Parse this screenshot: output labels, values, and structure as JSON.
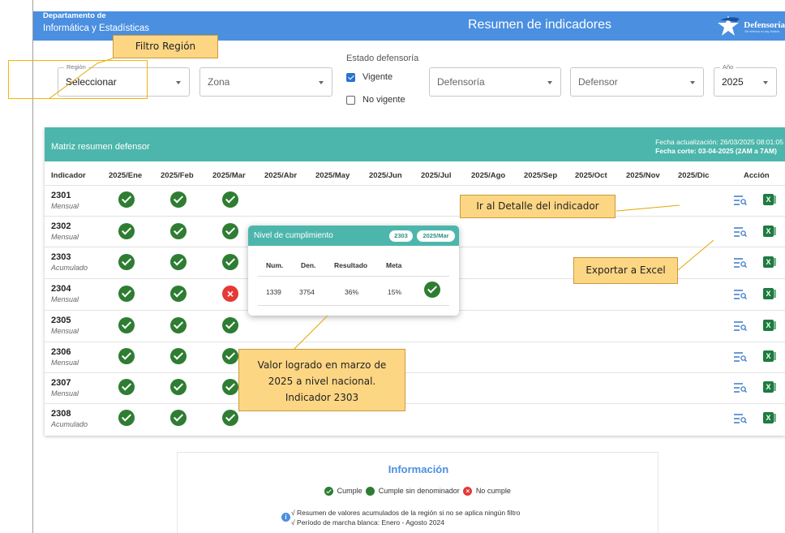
{
  "header": {
    "dept_line1": "Departamento de",
    "dept_line2": "Informática y Estadísticas",
    "title": "Resumen de indicadores",
    "logo_text": "Defensoría",
    "logo_tagline": "Sin defensa no hay Justicia"
  },
  "filters": {
    "region": {
      "legend": "Región",
      "value": "Seleccionar"
    },
    "zona": {
      "placeholder": "Zona"
    },
    "estado": {
      "label": "Estado defensoría",
      "vigente": "Vigente",
      "vigente_checked": true,
      "no_vigente": "No vigente",
      "no_vigente_checked": false
    },
    "defensoria": {
      "placeholder": "Defensoría"
    },
    "defensor": {
      "placeholder": "Defensor"
    },
    "anio": {
      "legend": "Año",
      "value": "2025"
    }
  },
  "matrix": {
    "title": "Matriz resumen defensor",
    "update_label": "Fecha actualización: 26/03/2025 08:01:05",
    "cut_label": "Fecha corte: 03-04-2025 (2AM a 7AM)",
    "columns": [
      "Indicador",
      "2025/Ene",
      "2025/Feb",
      "2025/Mar",
      "2025/Abr",
      "2025/May",
      "2025/Jun",
      "2025/Jul",
      "2025/Ago",
      "2025/Sep",
      "2025/Oct",
      "2025/Nov",
      "2025/Dic",
      "Acción"
    ],
    "rows": [
      {
        "id": "2301",
        "type": "Mensual",
        "status": [
          "ok",
          "ok",
          "ok"
        ]
      },
      {
        "id": "2302",
        "type": "Mensual",
        "status": [
          "ok",
          "ok",
          "ok"
        ]
      },
      {
        "id": "2303",
        "type": "Acumulado",
        "status": [
          "ok",
          "ok",
          "ok"
        ]
      },
      {
        "id": "2304",
        "type": "Mensual",
        "status": [
          "ok",
          "ok",
          "fail"
        ]
      },
      {
        "id": "2305",
        "type": "Mensual",
        "status": [
          "ok",
          "ok",
          "ok"
        ]
      },
      {
        "id": "2306",
        "type": "Mensual",
        "status": [
          "ok",
          "ok",
          "ok"
        ]
      },
      {
        "id": "2307",
        "type": "Mensual",
        "status": [
          "ok",
          "ok",
          "ok"
        ]
      },
      {
        "id": "2308",
        "type": "Acumulado",
        "status": [
          "ok",
          "ok",
          "ok"
        ]
      }
    ],
    "excel_glyph": "X",
    "fail_glyph": "×"
  },
  "popup": {
    "title": "Nivel de cumplimiento",
    "indicator_pill": "2303",
    "period_pill": "2025/Mar",
    "headers": [
      "Num.",
      "Den.",
      "Resultado",
      "Meta"
    ],
    "values": [
      "1339",
      "3754",
      "36%",
      "15%"
    ]
  },
  "callouts": {
    "region": "Filtro Región",
    "detail": "Ir al Detalle del indicador",
    "excel": "Exportar a Excel",
    "value_line1": "Valor logrado en marzo de",
    "value_line2": "2025 a nivel nacional.",
    "value_line3": "Indicador 2303"
  },
  "info": {
    "title": "Información",
    "legend_ok": "Cumple",
    "legend_noden": "Cumple sin denominador",
    "legend_fail": "No cumple",
    "note1": "√ Resumen de valores acumulados de la región si no se aplica ningún filtro",
    "note2": "√ Período de marcha blanca: Enero - Agosto 2024",
    "info_glyph": "i"
  },
  "colors": {
    "header": "#4a8fe0",
    "matrix_header": "#4db6ac",
    "ok": "#2e7d32",
    "fail": "#e53935",
    "callout": "#fdd684"
  }
}
